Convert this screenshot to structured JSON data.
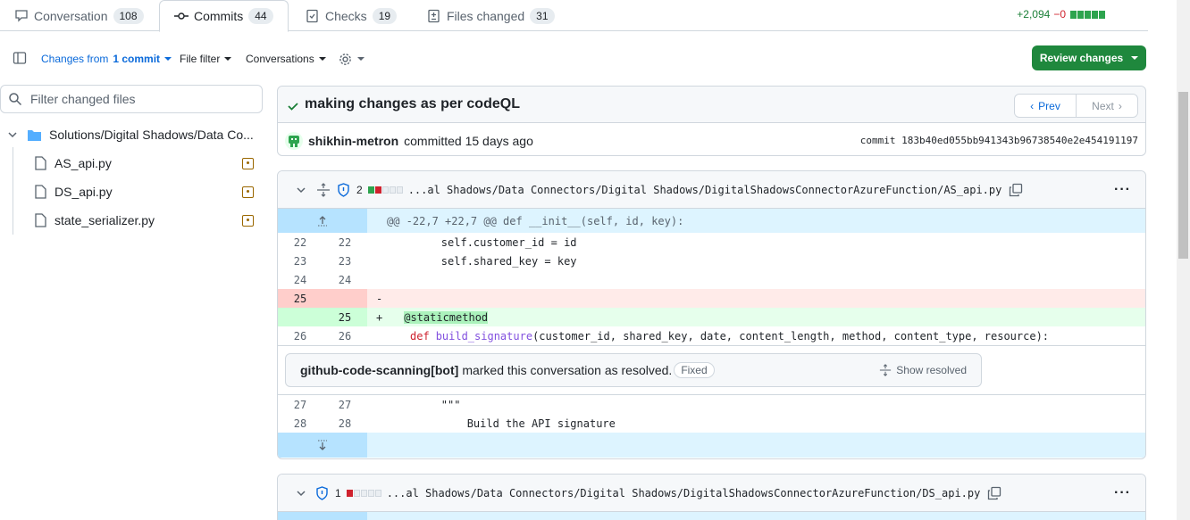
{
  "tabs": [
    {
      "label": "Conversation",
      "count": "108",
      "icon": "comment-icon"
    },
    {
      "label": "Commits",
      "count": "44",
      "icon": "commit-icon"
    },
    {
      "label": "Checks",
      "count": "19",
      "icon": "checklist-icon"
    },
    {
      "label": "Files changed",
      "count": "31",
      "icon": "diff-icon"
    }
  ],
  "stats": {
    "additions": "+2,094",
    "deletions": "−0"
  },
  "toolbar": {
    "changes_from": "Changes from",
    "commit_link": "1 commit",
    "file_filter": "File filter",
    "conversations": "Conversations",
    "review_changes": "Review changes"
  },
  "filter": {
    "placeholder": "Filter changed files"
  },
  "tree": {
    "folder": "Solutions/Digital Shadows/Data Co...",
    "files": [
      "AS_api.py",
      "DS_api.py",
      "state_serializer.py"
    ]
  },
  "commit": {
    "title": "making changes as per codeQL",
    "prev": "Prev",
    "next": "Next",
    "author": "shikhin-metron",
    "action": "committed 15 days ago",
    "sha_label": "commit",
    "sha": "183b40ed055bb941343b96738540e2e454191197"
  },
  "file1": {
    "alert_count": "2",
    "path": "...al Shadows/Data Connectors/Digital Shadows/DigitalShadowsConnectorAzureFunction/AS_api.py",
    "hunk": "@@ -22,7 +22,7 @@ def __init__(self, id, key):",
    "lines": [
      {
        "old": "22",
        "new": "22",
        "code": "        self.customer_id = id"
      },
      {
        "old": "23",
        "new": "23",
        "code": "        self.shared_key = key"
      },
      {
        "old": "24",
        "new": "24",
        "code": ""
      }
    ],
    "del": {
      "old": "25",
      "sign": "-",
      "code": ""
    },
    "add": {
      "new": "25",
      "sign": "+",
      "code": "@staticmethod"
    },
    "def_line": {
      "old": "26",
      "new": "26",
      "kw": "def",
      "fn": "build_signature",
      "rest": "(customer_id, shared_key, date, content_length, method, content_type, resource):"
    },
    "conversation": {
      "user": "github-code-scanning[bot]",
      "text": "marked this conversation as resolved.",
      "badge": "Fixed",
      "show": "Show resolved"
    },
    "after": [
      {
        "old": "27",
        "new": "27",
        "code": "        \"\"\""
      },
      {
        "old": "28",
        "new": "28",
        "code": "            Build the API signature"
      }
    ]
  },
  "file2": {
    "alert_count": "1",
    "path": "...al Shadows/Data Connectors/Digital Shadows/DigitalShadowsConnectorAzureFunction/DS_api.py"
  }
}
